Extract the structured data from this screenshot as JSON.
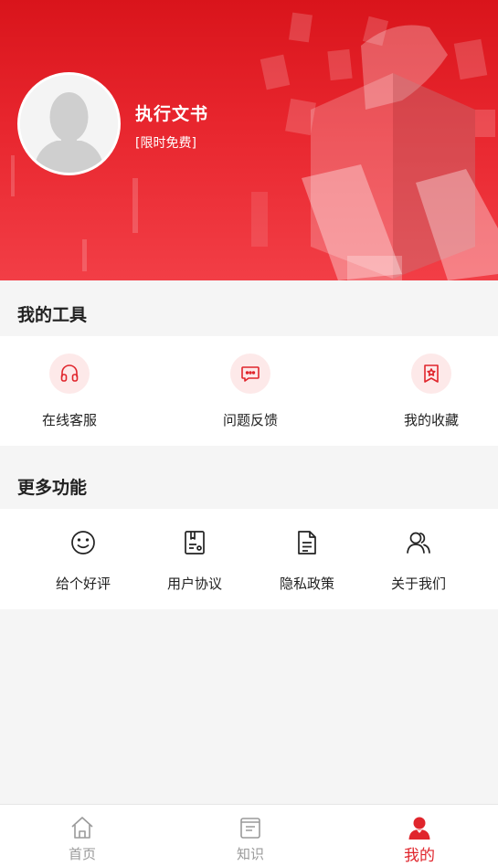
{
  "profile": {
    "name": "执行文书",
    "subtitle": "[限时免费]"
  },
  "tools_section": {
    "title": "我的工具",
    "items": [
      {
        "label": "在线客服",
        "icon": "headset-icon"
      },
      {
        "label": "问题反馈",
        "icon": "chat-bubble-icon"
      },
      {
        "label": "我的收藏",
        "icon": "bookmark-star-icon"
      }
    ]
  },
  "more_section": {
    "title": "更多功能",
    "items": [
      {
        "label": "给个好评",
        "icon": "smile-icon"
      },
      {
        "label": "用户协议",
        "icon": "agreement-icon"
      },
      {
        "label": "隐私政策",
        "icon": "document-icon"
      },
      {
        "label": "关于我们",
        "icon": "users-icon"
      }
    ]
  },
  "tabbar": {
    "items": [
      {
        "label": "首页",
        "icon": "home-icon",
        "active": false
      },
      {
        "label": "知识",
        "icon": "book-icon",
        "active": false
      },
      {
        "label": "我的",
        "icon": "person-icon",
        "active": true
      }
    ]
  },
  "colors": {
    "brand": "#e0252c",
    "icon_bg": "#fde9e9",
    "inactive": "#9a9a9a"
  }
}
